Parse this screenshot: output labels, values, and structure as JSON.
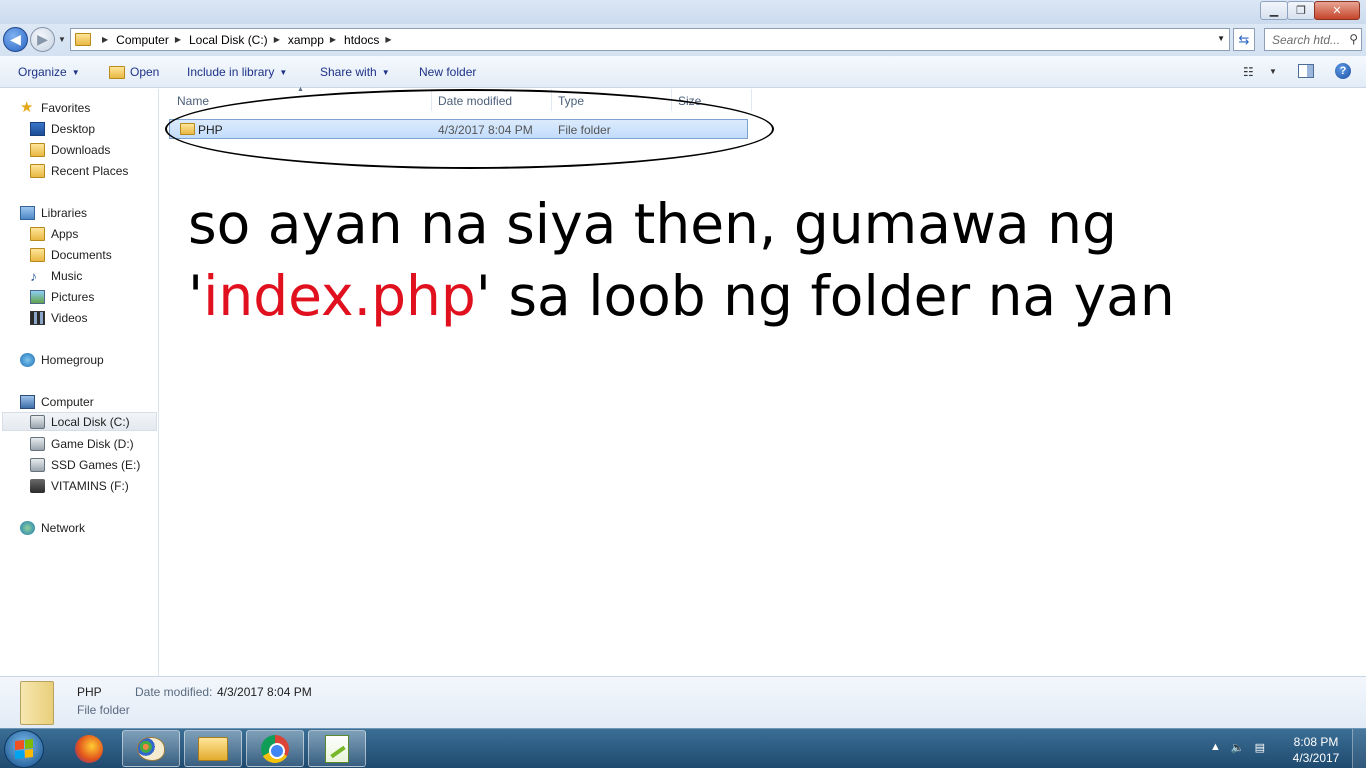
{
  "address": {
    "crumbs": [
      "Computer",
      "Local Disk (C:)",
      "xampp",
      "htdocs"
    ],
    "search_placeholder": "Search htd..."
  },
  "toolbar": {
    "organize": "Organize",
    "open": "Open",
    "include_in_library": "Include in library",
    "share_with": "Share with",
    "new_folder": "New folder"
  },
  "nav": {
    "favorites": "Favorites",
    "desktop": "Desktop",
    "downloads": "Downloads",
    "recent_places": "Recent Places",
    "libraries": "Libraries",
    "apps": "Apps",
    "documents": "Documents",
    "music": "Music",
    "pictures": "Pictures",
    "videos": "Videos",
    "homegroup": "Homegroup",
    "computer": "Computer",
    "local_disk": "Local Disk (C:)",
    "game_disk": "Game Disk (D:)",
    "ssd_games": "SSD Games (E:)",
    "vitamins": "VITAMINS (F:)",
    "network": "Network"
  },
  "columns": {
    "name": "Name",
    "date_modified": "Date modified",
    "type": "Type",
    "size": "Size"
  },
  "files": [
    {
      "name": "PHP",
      "date_modified": "4/3/2017 8:04 PM",
      "type": "File folder"
    }
  ],
  "caption": {
    "line1": "so ayan na siya then, gumawa ng",
    "quote_open": "'",
    "highlight": "index.php",
    "line2_rest": "' sa loob ng folder na yan",
    "highlight_color": "#e0101e"
  },
  "details": {
    "name": "PHP",
    "date_label": "Date modified:",
    "date_value": "4/3/2017 8:04 PM",
    "type": "File folder"
  },
  "taskbar": {
    "time": "8:08 PM",
    "date": "4/3/2017"
  }
}
